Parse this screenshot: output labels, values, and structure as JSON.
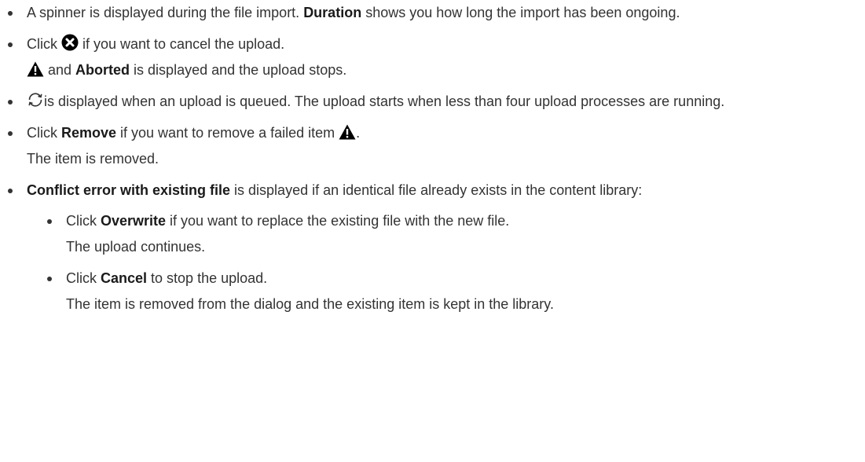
{
  "bullets": [
    {
      "before": "A spinner is displayed during the file import. ",
      "bold": "Duration",
      "after": " shows you how long the import has been ongoing."
    },
    {
      "before": "Click ",
      "after": " if you want to cancel the upload.",
      "icon": "cancel-circle-icon",
      "result_bold": "Aborted",
      "result_before": " and ",
      "result_after": " is displayed and the upload stops.",
      "result_icon": "warning-icon"
    },
    {
      "icon": "refresh-icon",
      "text": "is displayed when an upload is queued. The upload starts when less than four upload processes are running."
    },
    {
      "before": "Click ",
      "bold": "Remove",
      "after": " if you want to remove a failed item ",
      "icon": "warning-icon",
      "tail": ".",
      "result": "The item is removed."
    },
    {
      "bold": "Conflict error with existing file",
      "after": " is displayed if an identical file already exists in the content library:",
      "sub": [
        {
          "before": "Click ",
          "bold": "Overwrite",
          "after": " if you want to replace the existing file with the new file.",
          "result": "The upload continues."
        },
        {
          "before": "Click ",
          "bold": "Cancel",
          "after": " to stop the upload.",
          "result": "The item is removed from the dialog and the existing item is kept in the library."
        }
      ]
    }
  ],
  "colors": {
    "text": "#333333",
    "icon": "#000000"
  }
}
